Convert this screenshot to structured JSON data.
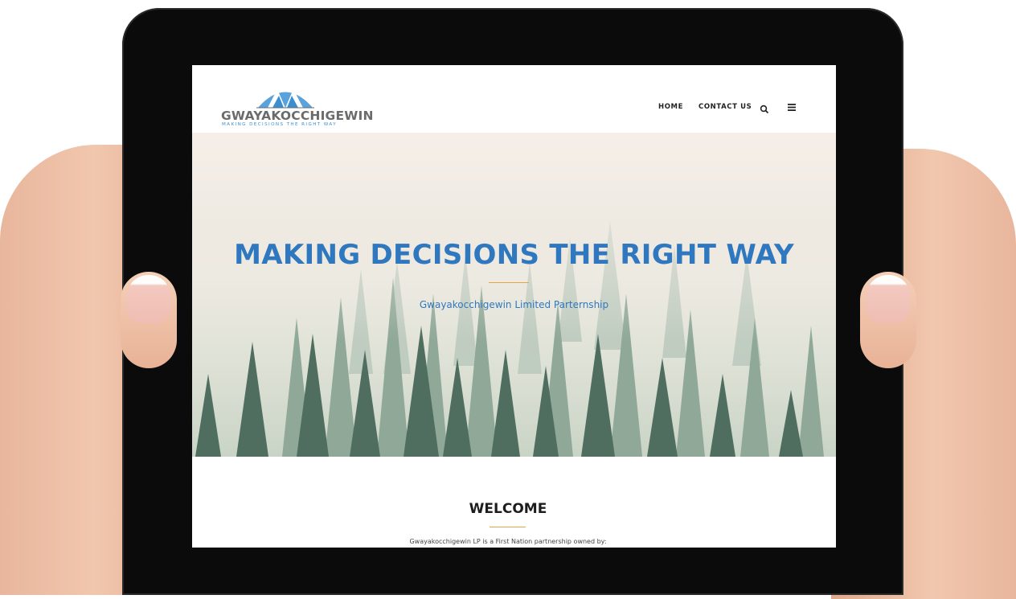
{
  "site": {
    "logo": {
      "name": "GWAYAKOCCHIGEWIN",
      "tagline": "MAKING DECISIONS THE RIGHT WAY"
    },
    "nav": {
      "home": "HOME",
      "contact": "CONTACT US",
      "search_icon": "search-icon",
      "menu_icon": "hamburger-menu-icon"
    },
    "hero": {
      "title": "MAKING DECISIONS THE RIGHT WAY",
      "subtitle": "Gwayakocchigewin Limited Parternship"
    },
    "welcome": {
      "title": "WELCOME",
      "text": "Gwayakocchigewin LP is a First Nation partnership owned by:"
    },
    "colors": {
      "brand_blue": "#2f78bf",
      "accent_orange": "#e8a24b",
      "logo_grey": "#6b6b6b"
    }
  }
}
